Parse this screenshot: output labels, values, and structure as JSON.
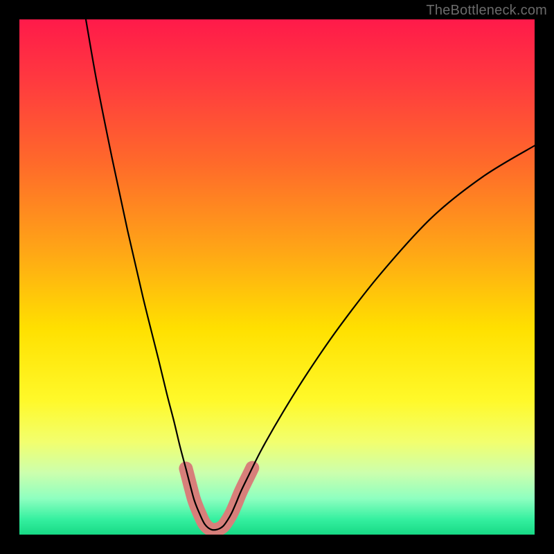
{
  "attribution": "TheBottleneck.com",
  "chart_data": {
    "type": "line",
    "title": "",
    "xlabel": "",
    "ylabel": "",
    "xlim": [
      0,
      100
    ],
    "ylim": [
      0,
      100
    ],
    "background_gradient": {
      "stops": [
        {
          "offset": 0.0,
          "color": "#ff1a4a"
        },
        {
          "offset": 0.12,
          "color": "#ff3a3f"
        },
        {
          "offset": 0.28,
          "color": "#ff6a2a"
        },
        {
          "offset": 0.45,
          "color": "#ffa616"
        },
        {
          "offset": 0.6,
          "color": "#ffe000"
        },
        {
          "offset": 0.74,
          "color": "#fff92a"
        },
        {
          "offset": 0.82,
          "color": "#f2ff6e"
        },
        {
          "offset": 0.88,
          "color": "#ccffad"
        },
        {
          "offset": 0.93,
          "color": "#8effc0"
        },
        {
          "offset": 0.97,
          "color": "#35f0a0"
        },
        {
          "offset": 1.0,
          "color": "#17d985"
        }
      ]
    },
    "series": [
      {
        "name": "bottleneck-curve",
        "x": [
          12.9,
          15.0,
          18.0,
          21.0,
          24.0,
          27.0,
          28.7,
          30.0,
          31.2,
          32.4,
          33.3,
          34.0,
          35.0,
          36.0,
          37.2,
          38.4,
          39.5,
          40.4,
          41.2,
          42.0,
          43.0,
          44.5,
          47.0,
          51.0,
          56.0,
          62.0,
          70.0,
          80.0,
          90.0,
          100.0
        ],
        "y": [
          100.0,
          88.0,
          73.0,
          59.0,
          46.0,
          34.0,
          27.0,
          22.0,
          17.0,
          12.5,
          9.0,
          6.5,
          4.0,
          2.0,
          1.0,
          1.0,
          1.6,
          2.8,
          4.2,
          6.0,
          8.4,
          11.5,
          16.5,
          23.5,
          31.5,
          40.2,
          50.5,
          61.5,
          69.5,
          75.5
        ],
        "color": "#000000",
        "width": 2.2
      }
    ],
    "highlight_band": {
      "threshold_y": 13.0,
      "color": "#d77f7a",
      "width": 20
    }
  }
}
